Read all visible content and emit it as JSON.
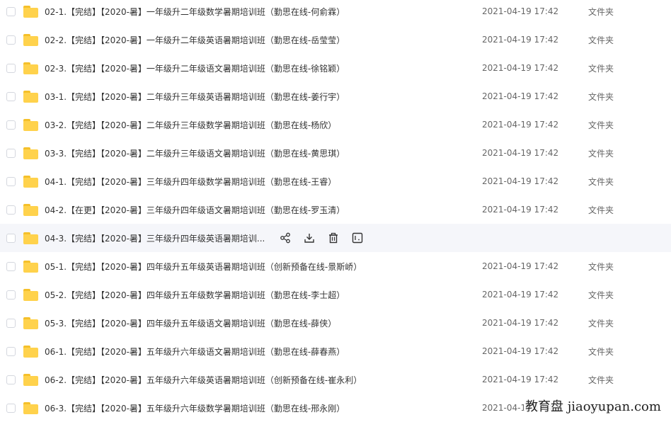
{
  "files": [
    {
      "name": "02-1.【完结】【2020-暑】一年级升二年级数学暑期培训班（勤思在线-何俞霖）",
      "date": "2021-04-19 17:42",
      "type": "文件夹"
    },
    {
      "name": "02-2.【完结】【2020-暑】一年级升二年级英语暑期培训班（勤思在线-岳莹莹）",
      "date": "2021-04-19 17:42",
      "type": "文件夹"
    },
    {
      "name": "02-3.【完结】【2020-暑】一年级升二年级语文暑期培训班（勤思在线-徐铭颖）",
      "date": "2021-04-19 17:42",
      "type": "文件夹"
    },
    {
      "name": "03-1.【完结】【2020-暑】二年级升三年级英语暑期培训班（勤思在线-姜行宇）",
      "date": "2021-04-19 17:42",
      "type": "文件夹"
    },
    {
      "name": "03-2.【完结】【2020-暑】二年级升三年级数学暑期培训班（勤思在线-杨欣）",
      "date": "2021-04-19 17:42",
      "type": "文件夹"
    },
    {
      "name": "03-3.【完结】【2020-暑】二年级升三年级语文暑期培训班（勤思在线-黄思琪）",
      "date": "2021-04-19 17:42",
      "type": "文件夹"
    },
    {
      "name": "04-1.【完结】【2020-暑】三年级升四年级数学暑期培训班（勤思在线-王睿）",
      "date": "2021-04-19 17:42",
      "type": "文件夹"
    },
    {
      "name": "04-2.【在更】【2020-暑】三年级升四年级语文暑期培训班（勤思在线-罗玉清）",
      "date": "2021-04-19 17:42",
      "type": "文件夹"
    },
    {
      "name": "04-3.【完结】【2020-暑】三年级升四年级英语暑期培训...",
      "date": "",
      "type": ""
    },
    {
      "name": "05-1.【完结】【2020-暑】四年级升五年级英语暑期培训班（创新预备在线-景斯峤）",
      "date": "2021-04-19 17:42",
      "type": "文件夹"
    },
    {
      "name": "05-2.【完结】【2020-暑】四年级升五年级数学暑期培训班（勤思在线-李士超）",
      "date": "2021-04-19 17:42",
      "type": "文件夹"
    },
    {
      "name": "05-3.【完结】【2020-暑】四年级升五年级语文暑期培训班（勤思在线-薛侠）",
      "date": "2021-04-19 17:42",
      "type": "文件夹"
    },
    {
      "name": "06-1.【完结】【2020-暑】五年级升六年级语文暑期培训班（勤思在线-薛春燕）",
      "date": "2021-04-19 17:42",
      "type": "文件夹"
    },
    {
      "name": "06-2.【完结】【2020-暑】五年级升六年级英语暑期培训班（创新预备在线-崔永利）",
      "date": "2021-04-19 17:42",
      "type": "文件夹"
    },
    {
      "name": "06-3.【完结】【2020-暑】五年级升六年级数学暑期培训班（勤思在线-邢永刚）",
      "date": "2021-04-19 17:42",
      "type": "文件夹"
    }
  ],
  "hover_row_index": 8,
  "row_actions": [
    "share-icon",
    "download-icon",
    "delete-icon",
    "more-icon"
  ],
  "watermark": "教育盘 jiaoyupan.com",
  "colors": {
    "folder": "#ffd24c",
    "hover": "#f5f6fa",
    "text": "#333333",
    "meta": "#666666"
  }
}
